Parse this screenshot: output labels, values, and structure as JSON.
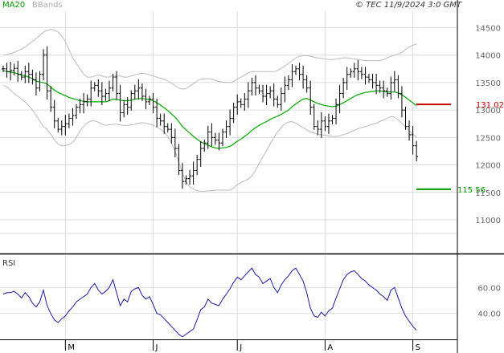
{
  "legend": {
    "ma_label": "MA20",
    "bb_label": "BBands",
    "ma_color": "#00aa00",
    "bb_color": "#bbbbbb"
  },
  "copyright": "© TEC 11/9/2024 3:0 GMT",
  "rsi_label": "RSI",
  "colors": {
    "price": "#000000",
    "resistance": "#cc0000",
    "support": "#009900",
    "rsi": "#1a1aa6",
    "grid": "#dcdcdc"
  },
  "chart_data": [
    {
      "type": "ohlc",
      "ylim": [
        10400,
        14800
      ],
      "y_ticks": [
        11000,
        11500,
        12000,
        12500,
        13000,
        13500,
        14000,
        14500
      ],
      "x_tick_labels": [
        {
          "label": "M",
          "index": 17
        },
        {
          "label": "J",
          "index": 41
        },
        {
          "label": "J",
          "index": 64
        },
        {
          "label": "A",
          "index": 88
        },
        {
          "label": "S",
          "index": 112
        }
      ],
      "levels": [
        {
          "name": "resistance",
          "value": 13102,
          "label": "131 02"
        },
        {
          "name": "support",
          "value": 11556,
          "label": "115 56"
        }
      ],
      "close": [
        13750,
        13700,
        13720,
        13760,
        13650,
        13600,
        13700,
        13650,
        13550,
        13400,
        13650,
        14000,
        13350,
        13050,
        12800,
        12650,
        12700,
        12750,
        12850,
        12900,
        13050,
        13100,
        13150,
        13200,
        13400,
        13450,
        13350,
        13250,
        13300,
        13400,
        13600,
        13300,
        12950,
        13100,
        13050,
        13300,
        13350,
        13400,
        13250,
        13150,
        13200,
        13050,
        12850,
        12800,
        12700,
        12650,
        12500,
        12300,
        11900,
        11700,
        11750,
        11800,
        11900,
        12100,
        12300,
        12400,
        12600,
        12500,
        12450,
        12400,
        12600,
        12700,
        12850,
        13050,
        13150,
        13100,
        13200,
        13350,
        13500,
        13400,
        13350,
        13250,
        13300,
        13350,
        13200,
        13100,
        13300,
        13450,
        13550,
        13700,
        13750,
        13650,
        13550,
        13400,
        13050,
        12700,
        12650,
        12800,
        12700,
        12800,
        12850,
        13100,
        13300,
        13500,
        13650,
        13700,
        13750,
        13700,
        13650,
        13600,
        13550,
        13500,
        13450,
        13400,
        13350,
        13300,
        13500,
        13550,
        13300,
        13000,
        12700,
        12550,
        12350,
        12150
      ]
    },
    {
      "type": "line",
      "name": "MA20",
      "values": [
        13720,
        13700,
        13690,
        13680,
        13660,
        13640,
        13620,
        13600,
        13570,
        13530,
        13510,
        13500,
        13470,
        13420,
        13360,
        13320,
        13290,
        13260,
        13230,
        13210,
        13190,
        13170,
        13160,
        13150,
        13150,
        13150,
        13150,
        13150,
        13150,
        13170,
        13200,
        13190,
        13180,
        13170,
        13170,
        13180,
        13200,
        13210,
        13210,
        13200,
        13190,
        13170,
        13130,
        13090,
        13040,
        12990,
        12930,
        12870,
        12790,
        12700,
        12640,
        12580,
        12520,
        12470,
        12420,
        12390,
        12360,
        12330,
        12310,
        12300,
        12310,
        12320,
        12340,
        12380,
        12430,
        12470,
        12520,
        12570,
        12630,
        12680,
        12720,
        12760,
        12790,
        12830,
        12860,
        12890,
        12920,
        12960,
        13000,
        13060,
        13110,
        13160,
        13200,
        13210,
        13180,
        13150,
        13120,
        13100,
        13080,
        13070,
        13060,
        13070,
        13100,
        13130,
        13170,
        13210,
        13250,
        13280,
        13300,
        13320,
        13330,
        13340,
        13350,
        13350,
        13340,
        13330,
        13330,
        13330,
        13310,
        13280,
        13230,
        13180,
        13130,
        13080
      ]
    },
    {
      "type": "line",
      "name": "BBands upper",
      "values": [
        14000,
        14010,
        14030,
        14050,
        14080,
        14110,
        14150,
        14200,
        14250,
        14300,
        14360,
        14420,
        14450,
        14470,
        14460,
        14420,
        14350,
        14250,
        14100,
        13950,
        13850,
        13750,
        13650,
        13600,
        13600,
        13620,
        13640,
        13620,
        13600,
        13600,
        13630,
        13620,
        13620,
        13600,
        13600,
        13620,
        13640,
        13660,
        13670,
        13660,
        13640,
        13620,
        13600,
        13580,
        13560,
        13530,
        13490,
        13440,
        13400,
        13380,
        13390,
        13430,
        13480,
        13530,
        13560,
        13570,
        13570,
        13560,
        13540,
        13520,
        13510,
        13500,
        13500,
        13520,
        13560,
        13600,
        13640,
        13680,
        13700,
        13700,
        13700,
        13700,
        13700,
        13700,
        13700,
        13720,
        13760,
        13800,
        13850,
        13900,
        13950,
        13980,
        13990,
        13990,
        13980,
        13960,
        13950,
        13940,
        13930,
        13920,
        13920,
        13930,
        13940,
        13950,
        13950,
        13940,
        13930,
        13920,
        13910,
        13900,
        13900,
        13900,
        13900,
        13900,
        13920,
        13950,
        13980,
        14000,
        14020,
        14050,
        14100,
        14150,
        14180,
        14200
      ]
    },
    {
      "type": "line",
      "name": "BBands lower",
      "values": [
        13450,
        13420,
        13360,
        13300,
        13250,
        13200,
        13150,
        13080,
        13000,
        12900,
        12800,
        12700,
        12650,
        12560,
        12450,
        12380,
        12350,
        12350,
        12370,
        12410,
        12500,
        12620,
        12700,
        12770,
        12800,
        12800,
        12780,
        12740,
        12720,
        12730,
        12740,
        12740,
        12730,
        12720,
        12720,
        12730,
        12740,
        12760,
        12770,
        12760,
        12740,
        12720,
        12690,
        12650,
        12600,
        12520,
        12400,
        12250,
        12050,
        11850,
        11700,
        11600,
        11560,
        11530,
        11520,
        11520,
        11530,
        11530,
        11540,
        11540,
        11540,
        11540,
        11540,
        11580,
        11640,
        11680,
        11710,
        11740,
        11800,
        11900,
        12030,
        12150,
        12260,
        12380,
        12500,
        12600,
        12680,
        12750,
        12780,
        12790,
        12760,
        12720,
        12680,
        12640,
        12600,
        12580,
        12560,
        12550,
        12540,
        12530,
        12520,
        12520,
        12530,
        12550,
        12570,
        12600,
        12630,
        12660,
        12680,
        12700,
        12720,
        12740,
        12760,
        12790,
        12820,
        12850,
        12880,
        12870,
        12820,
        12760,
        12690,
        12620,
        12560,
        12500
      ]
    },
    {
      "type": "line",
      "name": "RSI",
      "ylim": [
        20,
        85
      ],
      "y_ticks": [
        40,
        60
      ],
      "values": [
        55,
        56,
        56,
        57,
        55,
        52,
        56,
        53,
        48,
        45,
        49,
        58,
        46,
        40,
        35,
        33,
        36,
        38,
        42,
        45,
        49,
        51,
        53,
        55,
        60,
        63,
        58,
        55,
        57,
        60,
        66,
        56,
        46,
        51,
        49,
        57,
        59,
        60,
        54,
        51,
        53,
        47,
        40,
        39,
        36,
        33,
        30,
        27,
        24,
        22,
        24,
        26,
        28,
        35,
        43,
        45,
        51,
        48,
        47,
        46,
        51,
        55,
        59,
        64,
        68,
        66,
        69,
        72,
        75,
        70,
        68,
        63,
        65,
        67,
        60,
        56,
        62,
        66,
        69,
        73,
        75,
        70,
        65,
        56,
        44,
        38,
        37,
        41,
        38,
        42,
        44,
        52,
        59,
        66,
        70,
        72,
        73,
        70,
        67,
        65,
        62,
        60,
        58,
        55,
        53,
        50,
        58,
        60,
        52,
        44,
        38,
        34,
        30,
        27
      ]
    }
  ]
}
